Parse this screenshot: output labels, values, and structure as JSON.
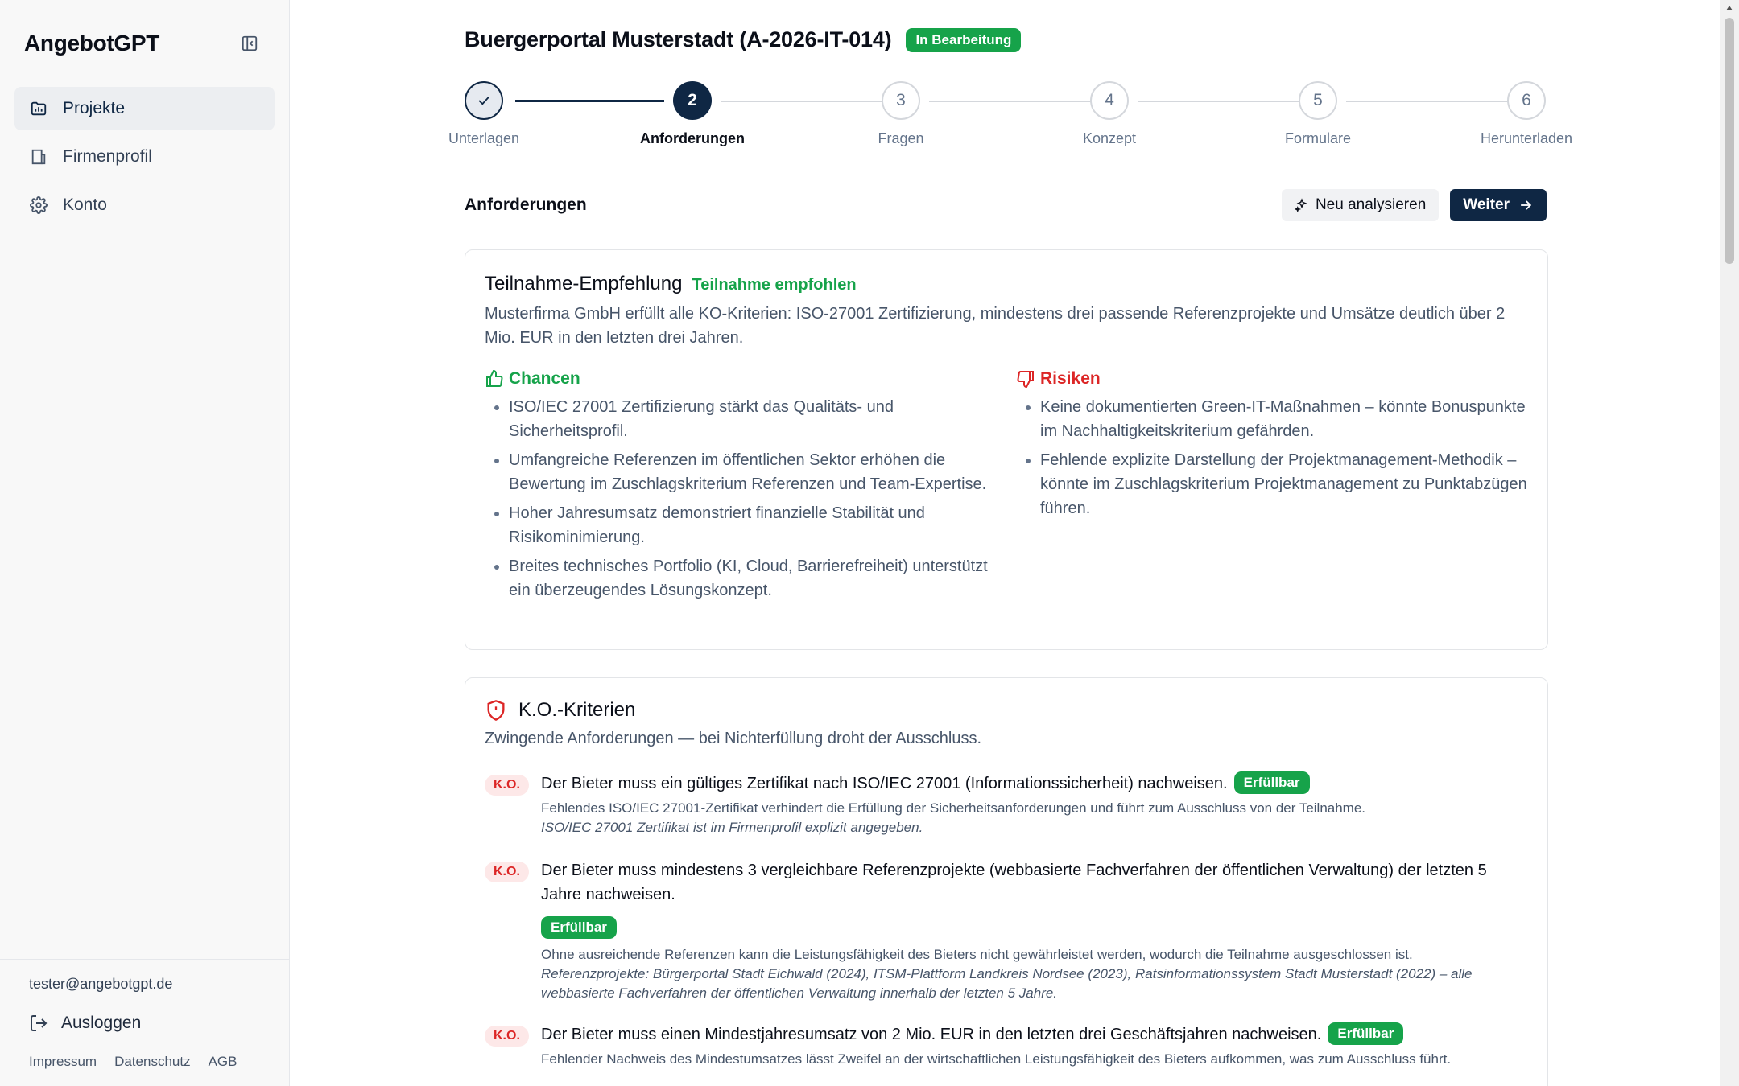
{
  "sidebar": {
    "brand": "AngebotGPT",
    "items": [
      {
        "label": "Projekte",
        "icon": "folder-chart-icon"
      },
      {
        "label": "Firmenprofil",
        "icon": "building-icon"
      },
      {
        "label": "Konto",
        "icon": "gear-icon"
      }
    ],
    "user_email": "tester@angebotgpt.de",
    "logout_label": "Ausloggen",
    "legal": [
      "Impressum",
      "Datenschutz",
      "AGB"
    ]
  },
  "header": {
    "title": "Buergerportal Musterstadt (A-2026-IT-014)",
    "status": "In Bearbeitung"
  },
  "stepper": {
    "steps": [
      {
        "number": "1",
        "label": "Unterlagen",
        "state": "done"
      },
      {
        "number": "2",
        "label": "Anforderungen",
        "state": "current"
      },
      {
        "number": "3",
        "label": "Fragen",
        "state": "todo"
      },
      {
        "number": "4",
        "label": "Konzept",
        "state": "todo"
      },
      {
        "number": "5",
        "label": "Formulare",
        "state": "todo"
      },
      {
        "number": "6",
        "label": "Herunterladen",
        "state": "todo"
      }
    ]
  },
  "section": {
    "title": "Anforderungen",
    "reanalyze_label": "Neu analysieren",
    "next_label": "Weiter"
  },
  "recommendation": {
    "title": "Teilnahme-Empfehlung",
    "verdict": "Teilnahme empfohlen",
    "summary": "Musterfirma GmbH erfüllt alle KO-Kriterien: ISO-27001 Zertifizierung, mindestens drei passende Referenzprojekte und Umsätze deutlich über 2 Mio. EUR in den letzten drei Jahren.",
    "chances_title": "Chancen",
    "chances": [
      "ISO/IEC 27001 Zertifizierung stärkt das Qualitäts- und Sicherheitsprofil.",
      "Umfangreiche Referenzen im öffentlichen Sektor erhöhen die Bewertung im Zuschlagskriterium Referenzen und Team-Expertise.",
      "Hoher Jahresumsatz demonstriert finanzielle Stabilität und Risikominimierung.",
      "Breites technisches Portfolio (KI, Cloud, Barrierefreiheit) unterstützt ein überzeugendes Lösungskonzept."
    ],
    "risks_title": "Risiken",
    "risks": [
      "Keine dokumentierten Green-IT-Maßnahmen – könnte Bonuspunkte im Nachhaltigkeitskriterium gefährden.",
      "Fehlende explizite Darstellung der Projektmanagement-Methodik – könnte im Zuschlagskriterium Projektmanagement zu Punktabzügen führen."
    ]
  },
  "ko": {
    "title": "K.O.-Kriterien",
    "subtitle": "Zwingende Anforderungen — bei Nichterfüllung droht der Ausschluss.",
    "tag": "K.O.",
    "items": [
      {
        "text": "Der Bieter muss ein gültiges Zertifikat nach ISO/IEC 27001 (Informationssicherheit) nachweisen.",
        "status": "Erfüllbar",
        "risk": "Fehlendes ISO/IEC 27001-Zertifikat verhindert die Erfüllung der Sicherheitsanforderungen und führt zum Ausschluss von der Teilnahme.",
        "note": "ISO/IEC 27001 Zertifikat ist im Firmenprofil explizit angegeben."
      },
      {
        "text": "Der Bieter muss mindestens 3 vergleichbare Referenzprojekte (webbasierte Fachverfahren der öffentlichen Verwaltung) der letzten 5 Jahre nachweisen.",
        "status": "Erfüllbar",
        "risk": "Ohne ausreichende Referenzen kann die Leistungsfähigkeit des Bieters nicht gewährleistet werden, wodurch die Teilnahme ausgeschlossen ist.",
        "note": "Referenzprojekte: Bürgerportal Stadt Eichwald (2024), ITSM-Plattform Landkreis Nordsee (2023), Ratsinformationssystem Stadt Musterstadt (2022) – alle webbasierte Fachverfahren der öffentlichen Verwaltung innerhalb der letzten 5 Jahre."
      },
      {
        "text": "Der Bieter muss einen Mindestjahresumsatz von 2 Mio. EUR in den letzten drei Geschäftsjahren nachweisen.",
        "status": "Erfüllbar",
        "risk": "Fehlender Nachweis des Mindestumsatzes lässt Zweifel an der wirtschaftlichen Leistungsfähigkeit des Bieters aufkommen, was zum Ausschluss führt."
      }
    ]
  },
  "colors": {
    "primary": "#0f2744",
    "success": "#16a34a",
    "danger": "#dc2626"
  }
}
